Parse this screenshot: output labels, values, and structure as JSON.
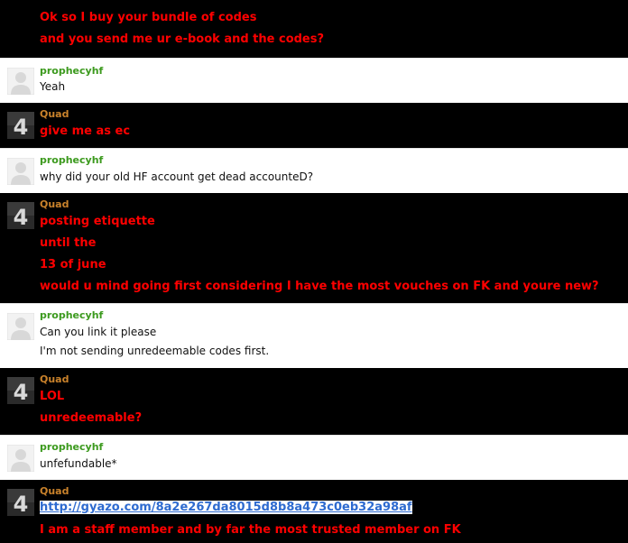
{
  "colors": {
    "quad_name": "#c9822b",
    "prophecy_name": "#3c9a1e",
    "quad_text": "#ff0000",
    "normal_text": "#111111",
    "link": "#2e6bd0"
  },
  "messages": [
    {
      "author": "",
      "lines": [
        "Ok so I buy your bundle of codes",
        "and you send me ur e-book and the codes?"
      ]
    },
    {
      "author": "prophecyhf",
      "lines": [
        "Yeah"
      ]
    },
    {
      "author": "Quad",
      "lines": [
        "give me as ec"
      ]
    },
    {
      "author": "prophecyhf",
      "lines": [
        "why did your old HF account get dead accounteD?"
      ]
    },
    {
      "author": "Quad",
      "lines": [
        "posting etiquette",
        "until the",
        "13 of june",
        "would u mind going first considering I have the most vouches on FK and youre new?"
      ]
    },
    {
      "author": "prophecyhf",
      "lines": [
        "Can you link it please",
        "I'm not sending unredeemable codes first."
      ]
    },
    {
      "author": "Quad",
      "lines": [
        "LOL",
        "unredeemable?"
      ]
    },
    {
      "author": "prophecyhf",
      "lines": [
        "unfefundable*"
      ]
    },
    {
      "author": "Quad",
      "link": "http://gyazo.com/8a2e267da8015d8b8a473c0eb32a98af",
      "lines": [
        "I am a staff member and by far the most trusted member on FK"
      ]
    }
  ]
}
